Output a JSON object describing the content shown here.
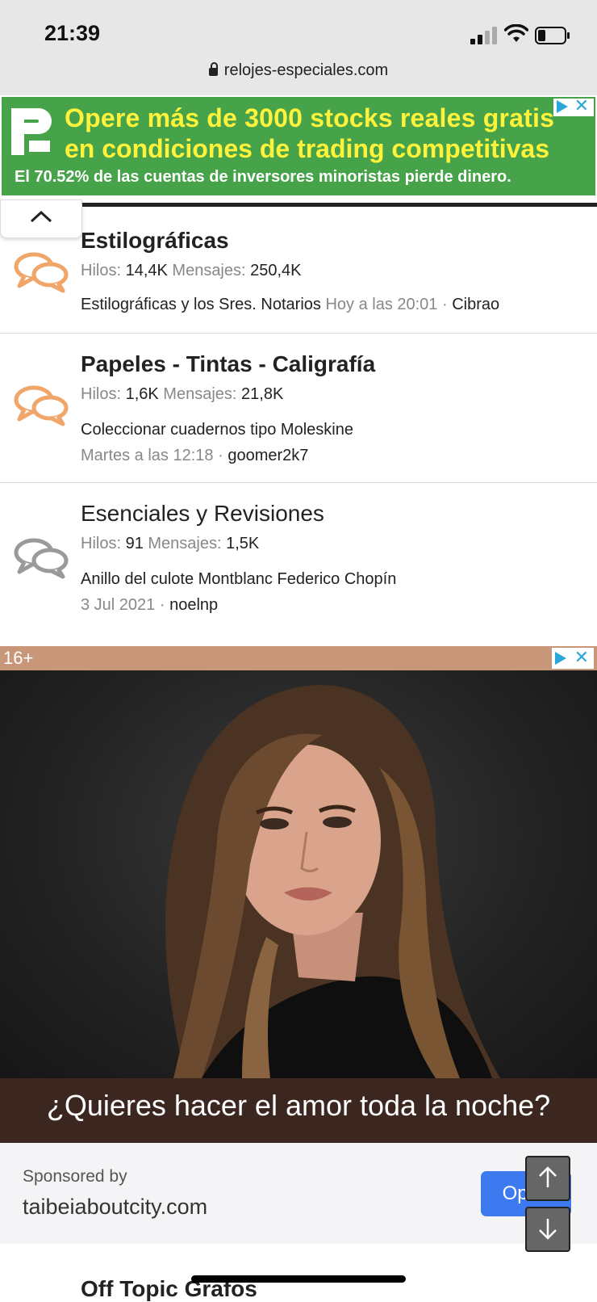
{
  "status": {
    "time": "21:39"
  },
  "browser": {
    "url": "relojes-especiales.com"
  },
  "top_ad": {
    "line1": "Opere más de 3000 stocks reales gratis",
    "line2": "en condiciones de trading competitivas",
    "line3": "El 70.52% de las cuentas de inversores minoristas pierde dinero.",
    "bg_color": "#47a34a",
    "headline_color": "#fff23a"
  },
  "forums": [
    {
      "title": "Estilográficas",
      "title_bold": true,
      "icon": "speech-bubbles-icon",
      "icon_color": "#f0a569",
      "threads_label": "Hilos:",
      "threads": "14,4K",
      "posts_label": "Mensajes:",
      "posts": "250,4K",
      "latest_thread": "Estilográficas y los Sres. Notarios",
      "latest_time": "Hoy a las 20:01",
      "latest_user": "Cibrao"
    },
    {
      "title": "Papeles - Tintas - Caligrafía",
      "title_bold": true,
      "icon": "speech-bubbles-icon",
      "icon_color": "#f0a569",
      "threads_label": "Hilos:",
      "threads": "1,6K",
      "posts_label": "Mensajes:",
      "posts": "21,8K",
      "latest_thread": "Coleccionar cuadernos tipo Moleskine",
      "latest_time": "Martes a las 12:18",
      "latest_user": "goomer2k7"
    },
    {
      "title": "Esenciales y Revisiones",
      "title_bold": false,
      "icon": "speech-bubbles-icon",
      "icon_color": "#9a9a9a",
      "threads_label": "Hilos:",
      "threads": "91",
      "posts_label": "Mensajes:",
      "posts": "1,5K",
      "latest_thread": "Anillo del culote Montblanc Federico Chopín",
      "latest_time": "3 Jul 2021",
      "latest_user": "noelnp"
    }
  ],
  "meta_separator": "·",
  "big_ad": {
    "age_label": "16+",
    "caption": "¿Quieres hacer el amor toda la noche?",
    "sponsored_by": "Sponsored by",
    "domain": "taibeiaboutcity.com",
    "open_label": "Open"
  },
  "next_forum_title": "Off Topic Grafos"
}
